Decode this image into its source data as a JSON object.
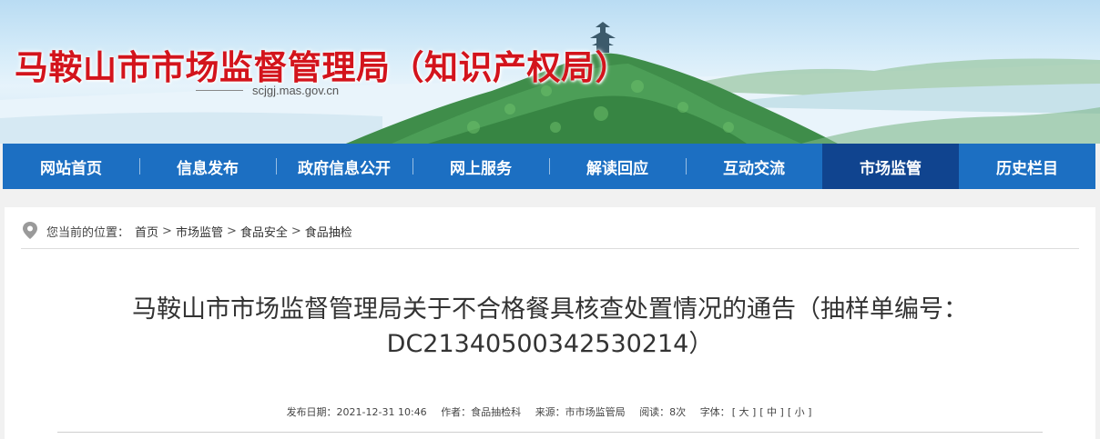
{
  "header": {
    "site_title": "马鞍山市市场监督管理局（知识产权局）",
    "site_domain": "scjgj.mas.gov.cn"
  },
  "nav": {
    "items": [
      {
        "label": "网站首页"
      },
      {
        "label": "信息发布"
      },
      {
        "label": "政府信息公开"
      },
      {
        "label": "网上服务"
      },
      {
        "label": "解读回应"
      },
      {
        "label": "互动交流"
      },
      {
        "label": "市场监管",
        "active": true
      },
      {
        "label": "历史栏目"
      }
    ],
    "colors": {
      "bar": "#1c6fc2",
      "active": "#10448f"
    }
  },
  "breadcrumb": {
    "prefix": "您当前的位置：",
    "items": [
      "首页",
      "市场监管",
      "食品安全",
      "食品抽检"
    ],
    "separator": ">"
  },
  "article": {
    "title_line1": "马鞍山市市场监督管理局关于不合格餐具核查处置情况的通告（抽样单编号：",
    "title_line2": "DC21340500342530214）",
    "meta": {
      "date": "发布日期：2021-12-31 10:46",
      "author": "作者：食品抽检科",
      "source": "来源：市市场监管局",
      "views": "阅读：8次",
      "font_label": "字体：",
      "font_large": "[ 大 ]",
      "font_medium": "[ 中 ]",
      "font_small": "[ 小 ]"
    }
  },
  "icons": {
    "location": "location-pin-icon"
  },
  "colors": {
    "title_red": "#d3141c",
    "page_bg": "#f1f1f1"
  }
}
